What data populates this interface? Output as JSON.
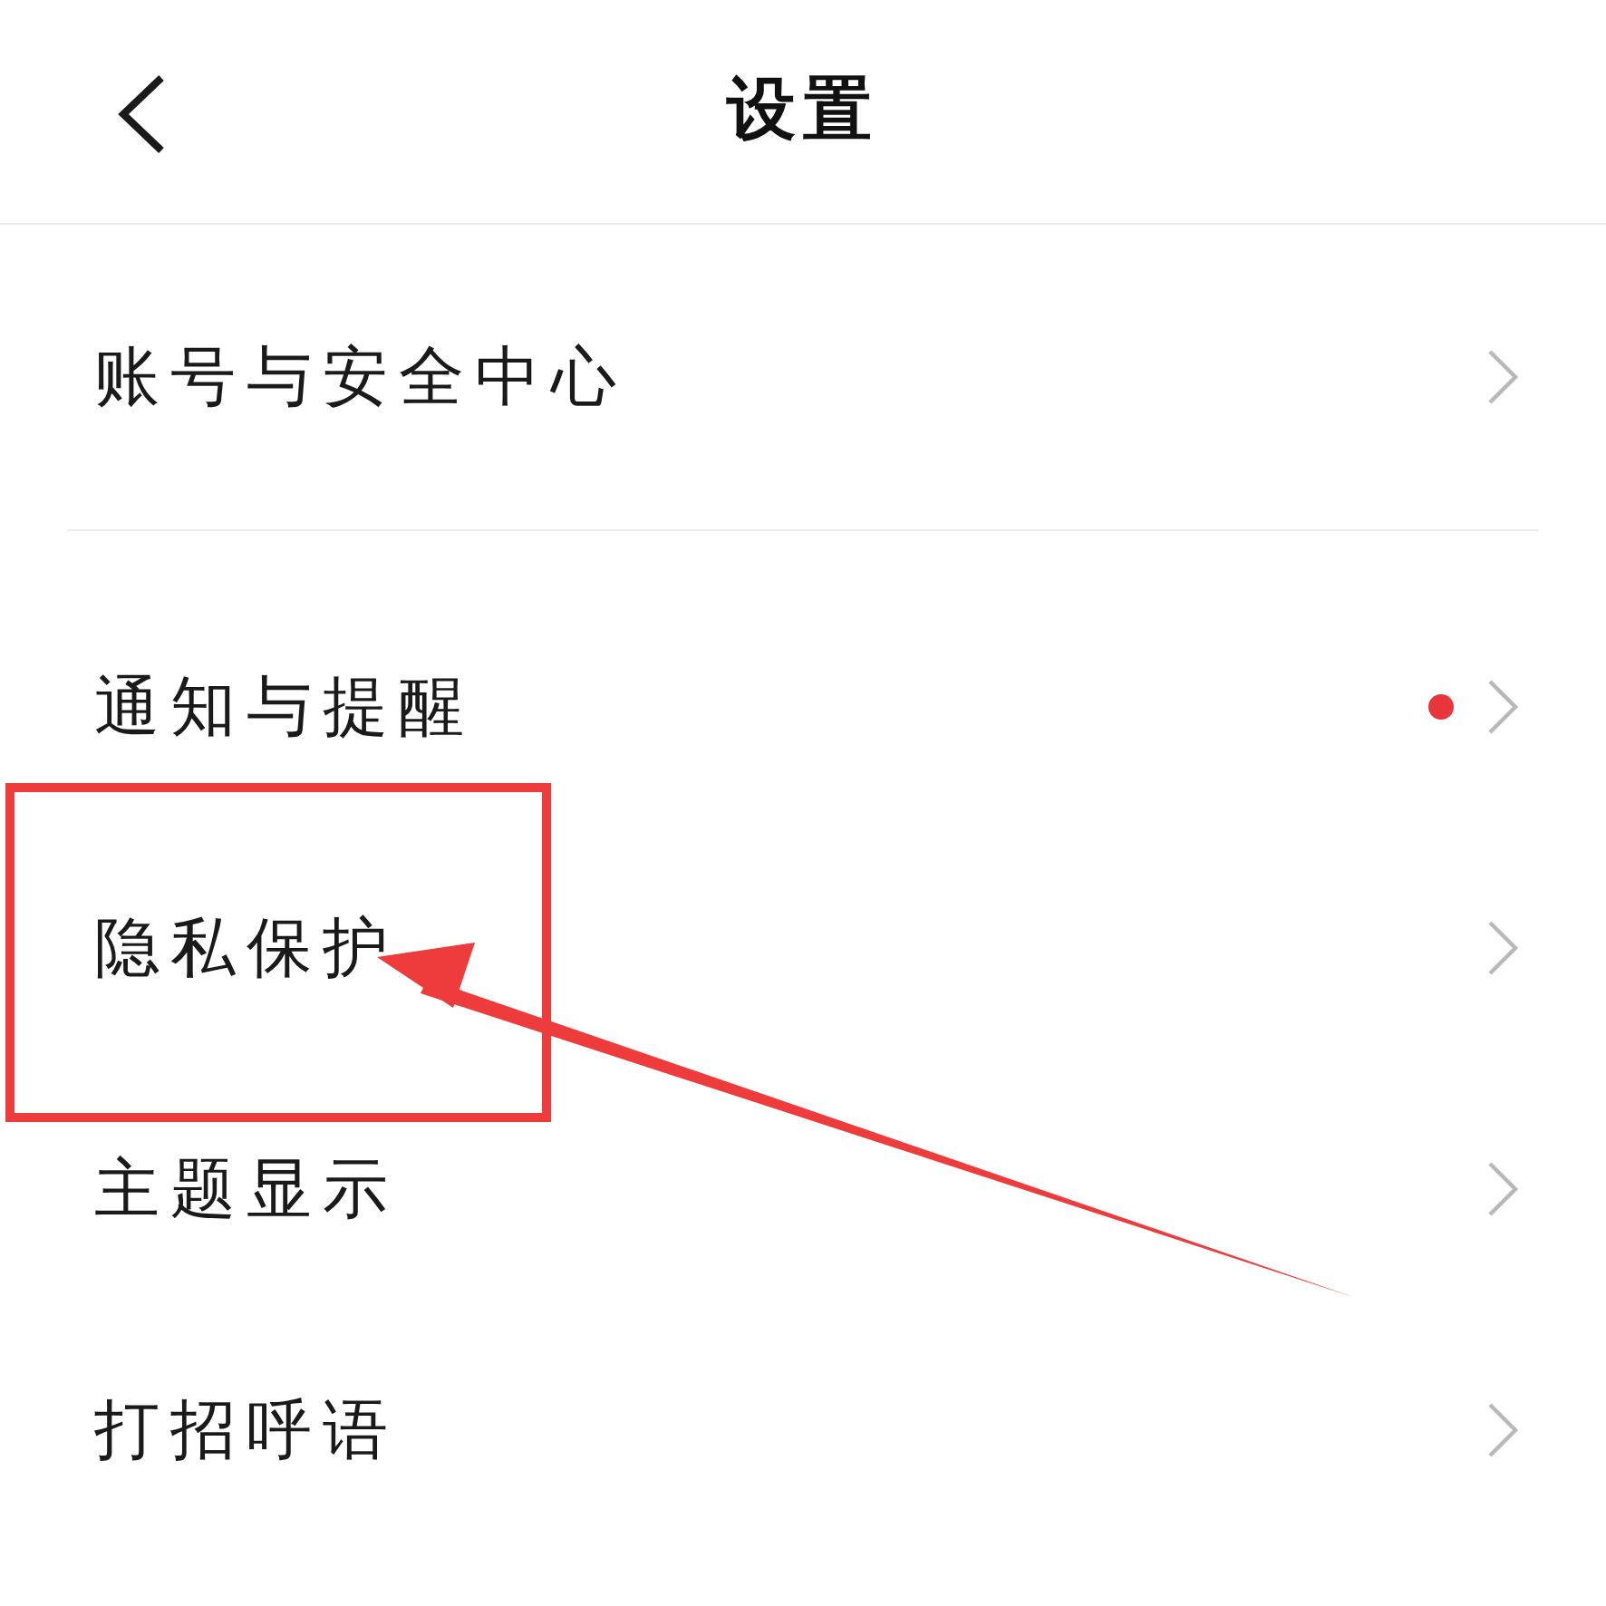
{
  "header": {
    "title": "设置"
  },
  "sections": [
    {
      "items": [
        {
          "label": "账号与安全中心",
          "badge": false
        }
      ]
    },
    {
      "items": [
        {
          "label": "通知与提醒",
          "badge": true
        },
        {
          "label": "隐私保护",
          "badge": false
        },
        {
          "label": "主题显示",
          "badge": false
        },
        {
          "label": "打招呼语",
          "badge": false
        }
      ]
    }
  ],
  "annotations": {
    "highlight_box": true,
    "arrow": true
  }
}
